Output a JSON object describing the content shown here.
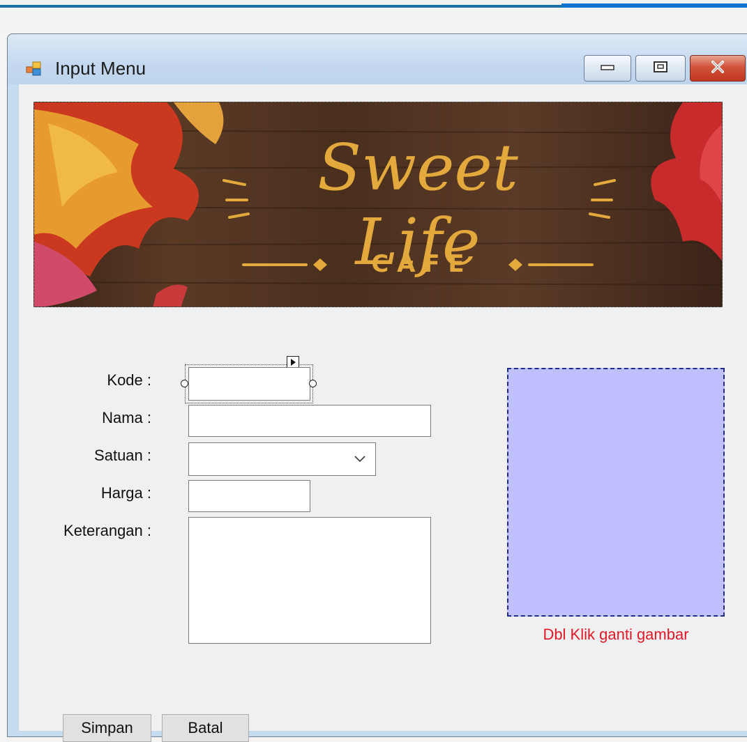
{
  "window": {
    "title": "Input Menu"
  },
  "banner": {
    "brand_script": "Sweet Life",
    "brand_sub": "C A F E"
  },
  "form": {
    "kode_label": "Kode :",
    "nama_label": "Nama :",
    "satuan_label": "Satuan :",
    "harga_label": "Harga :",
    "keterangan_label": "Keterangan :",
    "kode_value": "",
    "nama_value": "",
    "satuan_value": "",
    "harga_value": "",
    "keterangan_value": ""
  },
  "picture": {
    "caption": "Dbl Klik ganti gambar",
    "fill_color": "#c0c0ff",
    "caption_color": "#e0182a"
  },
  "buttons": {
    "save_label": "Simpan",
    "cancel_label": "Batal"
  },
  "icons": [
    "form-app-icon",
    "minimize-icon",
    "maximize-icon",
    "close-icon",
    "chevron-down-icon",
    "smart-tag-arrow-icon"
  ]
}
